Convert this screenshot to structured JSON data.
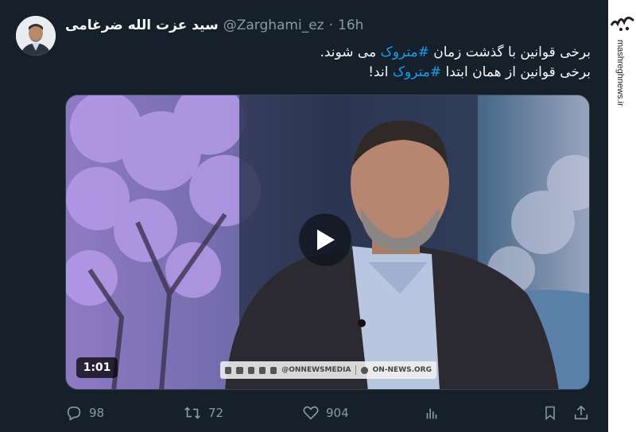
{
  "tweet": {
    "display_name": "سید عزت الله ضرغامی",
    "handle": "@Zarghami_ez",
    "separator": "·",
    "time": "16h",
    "line1_before": "برخی قوانین با گذشت زمان ",
    "line1_hashtag": "#متروک",
    "line1_after": " می شوند.",
    "line2_before": "برخی قوانین از همان ابتدا ",
    "line2_hashtag": "#متروک",
    "line2_after": " اند!"
  },
  "media": {
    "duration": "1:01",
    "brand_handle": "@ONNEWSMEDIA",
    "brand_site": "ON-NEWS.ORG"
  },
  "actions": {
    "replies": "98",
    "reposts": "72",
    "likes": "904"
  },
  "watermark": {
    "site": "mashreghnews.ir",
    "logo_text": "مشرق"
  },
  "icons": {
    "reply": "reply-icon",
    "repost": "repost-icon",
    "like": "heart-icon",
    "views": "analytics-icon",
    "bookmark": "bookmark-icon",
    "share": "share-icon",
    "play": "play-icon"
  },
  "colors": {
    "background": "#15202b",
    "text": "#f7f9f9",
    "muted": "#8b98a5",
    "accent": "#1d9bf0"
  }
}
